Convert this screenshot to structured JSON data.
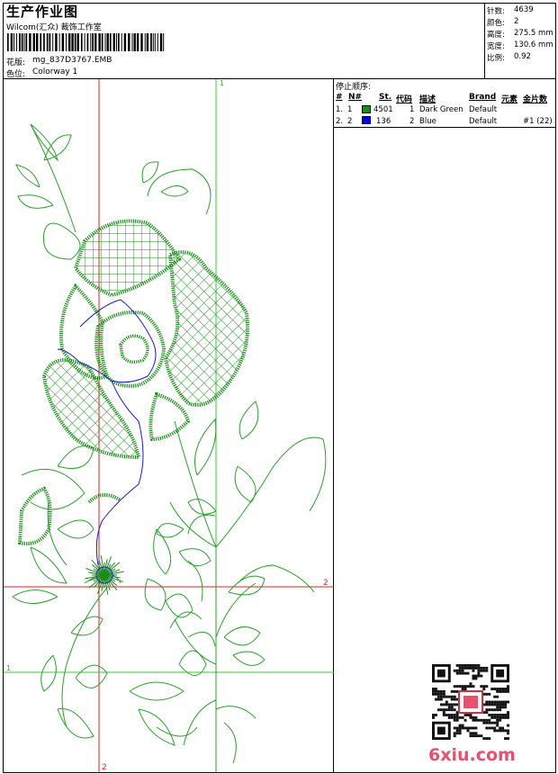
{
  "header": {
    "title": "生产作业图",
    "company": "Wilcom(汇众) 裁饰工作室",
    "design_label": "花版:",
    "design_value": "mg_837D3767.EMB",
    "colorway_label": "色位:",
    "colorway_value": "Colorway 1"
  },
  "stats": [
    {
      "label": "针数:",
      "value": "4639"
    },
    {
      "label": "颜色:",
      "value": "2"
    },
    {
      "label": "高度:",
      "value": "275.5 mm"
    },
    {
      "label": "宽度:",
      "value": "130.6 mm"
    },
    {
      "label": "比例:",
      "value": "0.92"
    }
  ],
  "stop_sequence": {
    "title": "停止顺序:",
    "columns": [
      "#",
      "N#",
      "St.",
      "代码",
      "描述",
      "Brand",
      "元素",
      "金片数"
    ],
    "rows": [
      {
        "num": "1.",
        "n": "1",
        "color": "#1a8c1a",
        "st": "4501",
        "code": "1",
        "desc": "Dark Green",
        "brand": "Default",
        "elem": "",
        "seq": ""
      },
      {
        "num": "2.",
        "n": "2",
        "color": "#0000e0",
        "st": "136",
        "code": "2",
        "desc": "Blue",
        "brand": "Default",
        "elem": "",
        "seq": "#1 (22)"
      }
    ]
  },
  "guides": {
    "v1_label": "1",
    "v2_label": "2",
    "h1_label": "1",
    "h2_label": "2"
  },
  "colors": {
    "thread_green": "#1a8c1a",
    "outline_green": "#2aa02a",
    "thread_blue": "#1a1ad0",
    "guide_green": "#33cc33",
    "guide_red": "#e02020"
  },
  "watermark": "6xiu.com"
}
